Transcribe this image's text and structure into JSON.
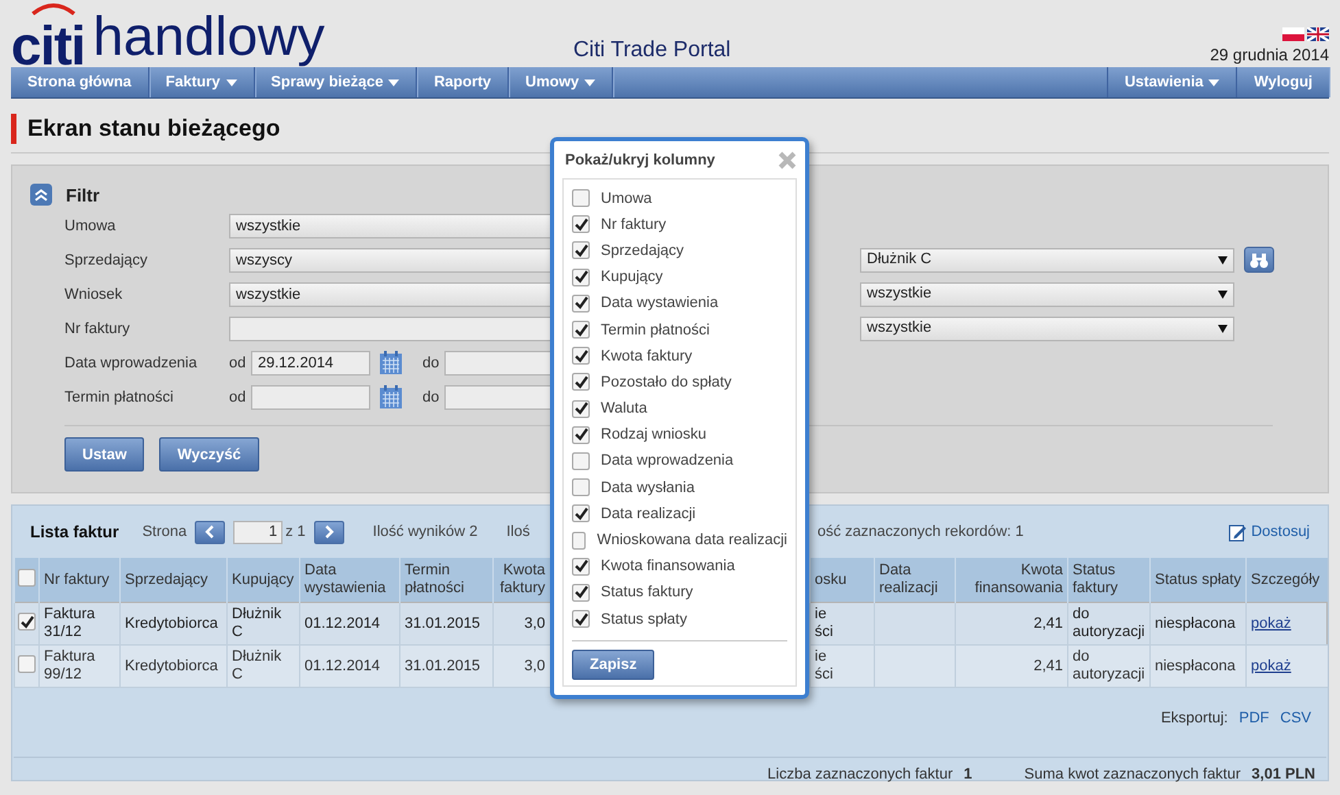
{
  "header": {
    "logo": {
      "brand": "citi",
      "name": "handlowy"
    },
    "portal_title": "Citi Trade Portal",
    "date": "29 grudnia 2014"
  },
  "nav": {
    "left": [
      {
        "label": "Strona główna",
        "menu": false
      },
      {
        "label": "Faktury",
        "menu": true
      },
      {
        "label": "Sprawy bieżące",
        "menu": true
      },
      {
        "label": "Raporty",
        "menu": false
      },
      {
        "label": "Umowy",
        "menu": true
      }
    ],
    "right": [
      {
        "label": "Ustawienia",
        "menu": true
      },
      {
        "label": "Wyloguj",
        "menu": false
      }
    ]
  },
  "page_title": "Ekran stanu bieżącego",
  "filter": {
    "title": "Filtr",
    "expanded": true,
    "rows": [
      {
        "label": "Umowa",
        "kind": "select",
        "value": "wszystkie"
      },
      {
        "label": "Sprzedający",
        "kind": "select",
        "value": "wszyscy",
        "right": {
          "value": "Dłużnik C",
          "search": true
        }
      },
      {
        "label": "Wniosek",
        "kind": "select",
        "value": "wszystkie",
        "right": {
          "value": "wszystkie",
          "search": false
        }
      },
      {
        "label": "Nr faktury",
        "kind": "text",
        "right": {
          "value": "wszystkie",
          "search": false
        }
      },
      {
        "label": "Data wprowadzenia",
        "kind": "daterange",
        "from_label": "od",
        "from_value": "29.12.2014",
        "to_label": "do"
      },
      {
        "label": "Termin płatności",
        "kind": "daterange",
        "from_label": "od",
        "to_label": "do"
      }
    ],
    "buttons": [
      "Ustaw",
      "Wyczyść"
    ]
  },
  "table": {
    "toolbar": {
      "title": "Lista faktur",
      "page_label": "Strona",
      "page": "1",
      "page_total": "z 1",
      "results": "Ilość wyników 2",
      "selected_left": "Iloś",
      "selected_right": "ość zaznaczonych rekordów: 1",
      "customize": "Dostosuj"
    },
    "select_all_checked": false,
    "columns": [
      {
        "label": "Nr faktury",
        "kind": "text"
      },
      {
        "label": "Sprzedający",
        "kind": "text"
      },
      {
        "label": "Kupujący",
        "kind": "text"
      },
      {
        "label": "Data wystawienia",
        "kind": "text"
      },
      {
        "label": "Termin płatności",
        "kind": "text"
      },
      {
        "label": "Kwota faktury",
        "kind": "amount"
      },
      {
        "label": "osku",
        "kind": "text"
      },
      {
        "label": "Data realizacji",
        "kind": "text"
      },
      {
        "label": "Kwota finansowania",
        "kind": "amount"
      },
      {
        "label": "Status faktury",
        "kind": "text"
      },
      {
        "label": "Status spłaty",
        "kind": "text"
      },
      {
        "label": "Szczegóły",
        "kind": "link"
      }
    ],
    "rows": [
      {
        "checked": true,
        "cells": [
          "Faktura 31/12",
          "Kredytobiorca",
          "Dłużnik C",
          "01.12.2014",
          "31.01.2015",
          "3,0",
          "ie\nści",
          null,
          "2,41",
          "do autoryzacji",
          "niespłacona",
          "pokaż"
        ]
      },
      {
        "checked": false,
        "cells": [
          "Faktura 99/12",
          "Kredytobiorca",
          "Dłużnik C",
          "01.12.2014",
          "31.01.2015",
          "3,0",
          "ie\nści",
          null,
          "2,41",
          "do autoryzacji",
          "niespłacona",
          "pokaż"
        ]
      }
    ],
    "export": {
      "label": "Eksportuj:",
      "formats": [
        "PDF",
        "CSV"
      ]
    },
    "summary": {
      "count_label": "Liczba zaznaczonych faktur",
      "count": "1",
      "sum_label": "Suma kwot zaznaczonych faktur",
      "sum": "3,01 PLN"
    }
  },
  "popup": {
    "title": "Pokaż/ukryj kolumny",
    "options": [
      {
        "label": "Umowa",
        "checked": false
      },
      {
        "label": "Nr faktury",
        "checked": true
      },
      {
        "label": "Sprzedający",
        "checked": true
      },
      {
        "label": "Kupujący",
        "checked": true
      },
      {
        "label": "Data wystawienia",
        "checked": true
      },
      {
        "label": "Termin płatności",
        "checked": true
      },
      {
        "label": "Kwota faktury",
        "checked": true
      },
      {
        "label": "Pozostało do spłaty",
        "checked": true
      },
      {
        "label": "Waluta",
        "checked": true
      },
      {
        "label": "Rodzaj wniosku",
        "checked": true
      },
      {
        "label": "Data wprowadzenia",
        "checked": false
      },
      {
        "label": "Data wysłania",
        "checked": false
      },
      {
        "label": "Data realizacji",
        "checked": true
      },
      {
        "label": "Wnioskowana data realizacji",
        "checked": false
      },
      {
        "label": "Kwota finansowania",
        "checked": true
      },
      {
        "label": "Status faktury",
        "checked": true
      },
      {
        "label": "Status spłaty",
        "checked": true
      }
    ],
    "save": "Zapisz"
  }
}
